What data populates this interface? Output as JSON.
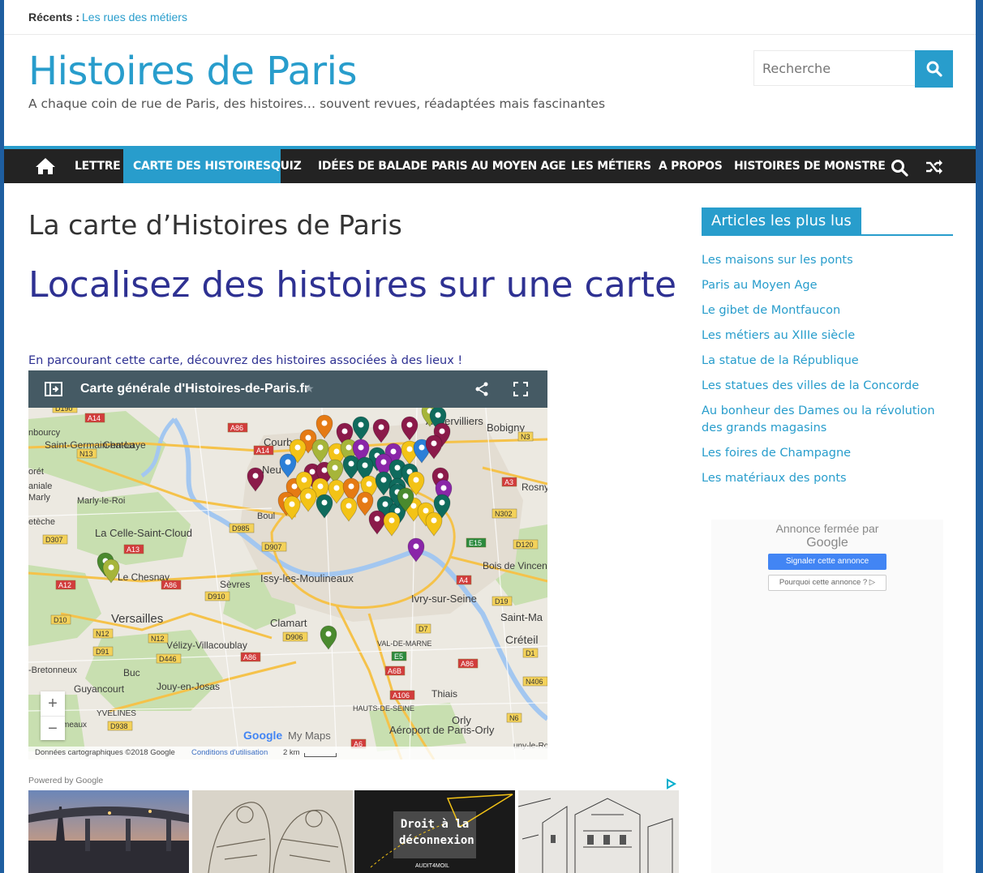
{
  "topbar": {
    "label": "Récents :",
    "link": "Les rues des métiers"
  },
  "header": {
    "title": "Histoires de Paris",
    "tagline": "A chaque coin de rue de Paris, des histoires… souvent revues, réadaptées mais fascinantes",
    "search_placeholder": "Recherche"
  },
  "nav": {
    "items": [
      "LETTRE",
      "CARTE DES HISTOIRES",
      "QUIZ",
      "IDÉES DE BALADE",
      "PARIS AU MOYEN AGE",
      "LES MÉTIERS",
      "A PROPOS",
      "HISTOIRES DE MONSTRE"
    ],
    "active": "CARTE DES HISTOIRES"
  },
  "main": {
    "page_title": "La carte d’Histoires de Paris",
    "heading": "Localisez des histoires sur une carte",
    "intro": "En parcourant cette carte, découvrez des histoires associées à des lieux !"
  },
  "map": {
    "title": "Carte générale d'Histoires-de-Paris.fr",
    "labels": [
      "Saint-Germain-en-Laye",
      "Chatou",
      "Courbe",
      "Neu",
      "Bobigny",
      "Aubervilliers",
      "Rosny",
      "Marly-le-Roi",
      "La Celle-Saint-Cloud",
      "Boul",
      "Le Chesnay",
      "Sèvres",
      "Issy-les-Moulineaux",
      "Bois de Vincennes",
      "Ivry-sur-Seine",
      "Versailles",
      "Clamart",
      "Saint-Ma",
      "Créteil",
      "Vélizy-Villacoublay",
      "Buc",
      "Jouy-en-Josas",
      "Guyancourt",
      "Thiais",
      "Orly",
      "Aéroport de Paris-Orly",
      "-Bretonneux",
      "YVELINES",
      "meaux",
      "HAUTS-DE-SEINE",
      "VAL-DE-MARNE",
      "uny-le-Roi",
      "orét",
      "aniale",
      "Marly",
      "etèche",
      "nbourcy"
    ],
    "roads": [
      "D190",
      "A14",
      "A86",
      "N3",
      "N13",
      "A14",
      "A3",
      "N302",
      "D985",
      "D307",
      "A13",
      "D907",
      "E15",
      "D120",
      "A12",
      "A86",
      "D910",
      "A4",
      "D19",
      "D10",
      "N12",
      "N12",
      "D906",
      "D7",
      "D91",
      "D446",
      "A86",
      "D1",
      "E5",
      "A6B",
      "A86",
      "N406",
      "A106",
      "D938",
      "N6",
      "A6"
    ],
    "zoom_in": "+",
    "zoom_out": "−",
    "footer_data": "Données cartographiques ©2018 Google",
    "footer_terms": "Conditions d'utilisation",
    "footer_scale": "2 km",
    "brand": "Google My Maps"
  },
  "sidebar": {
    "widget_title": "Articles les plus lus",
    "links": [
      "Les maisons sur les ponts",
      "Paris au Moyen Age",
      "Le gibet de Montfaucon",
      "Les métiers au XIIIe siècle",
      "La statue de la République",
      "Les statues des villes de la Concorde",
      "Au bonheur des Dames ou la révolution des grands magasins",
      "Les foires de Champagne",
      "Les matériaux des ponts"
    ],
    "ad": {
      "closed": "Annonce fermée par",
      "google": "Google",
      "report": "Signaler cette annonce",
      "why": "Pourquoi cette annonce ? ▷"
    }
  },
  "ads": {
    "powered": "Powered by Google",
    "tile3_text": "Droit à la déconnexion",
    "tile3_brand": "AUDIT4MOIL"
  },
  "colors": {
    "accent": "#289dcc",
    "nav_bg": "#232323",
    "heading": "#2e3192"
  }
}
